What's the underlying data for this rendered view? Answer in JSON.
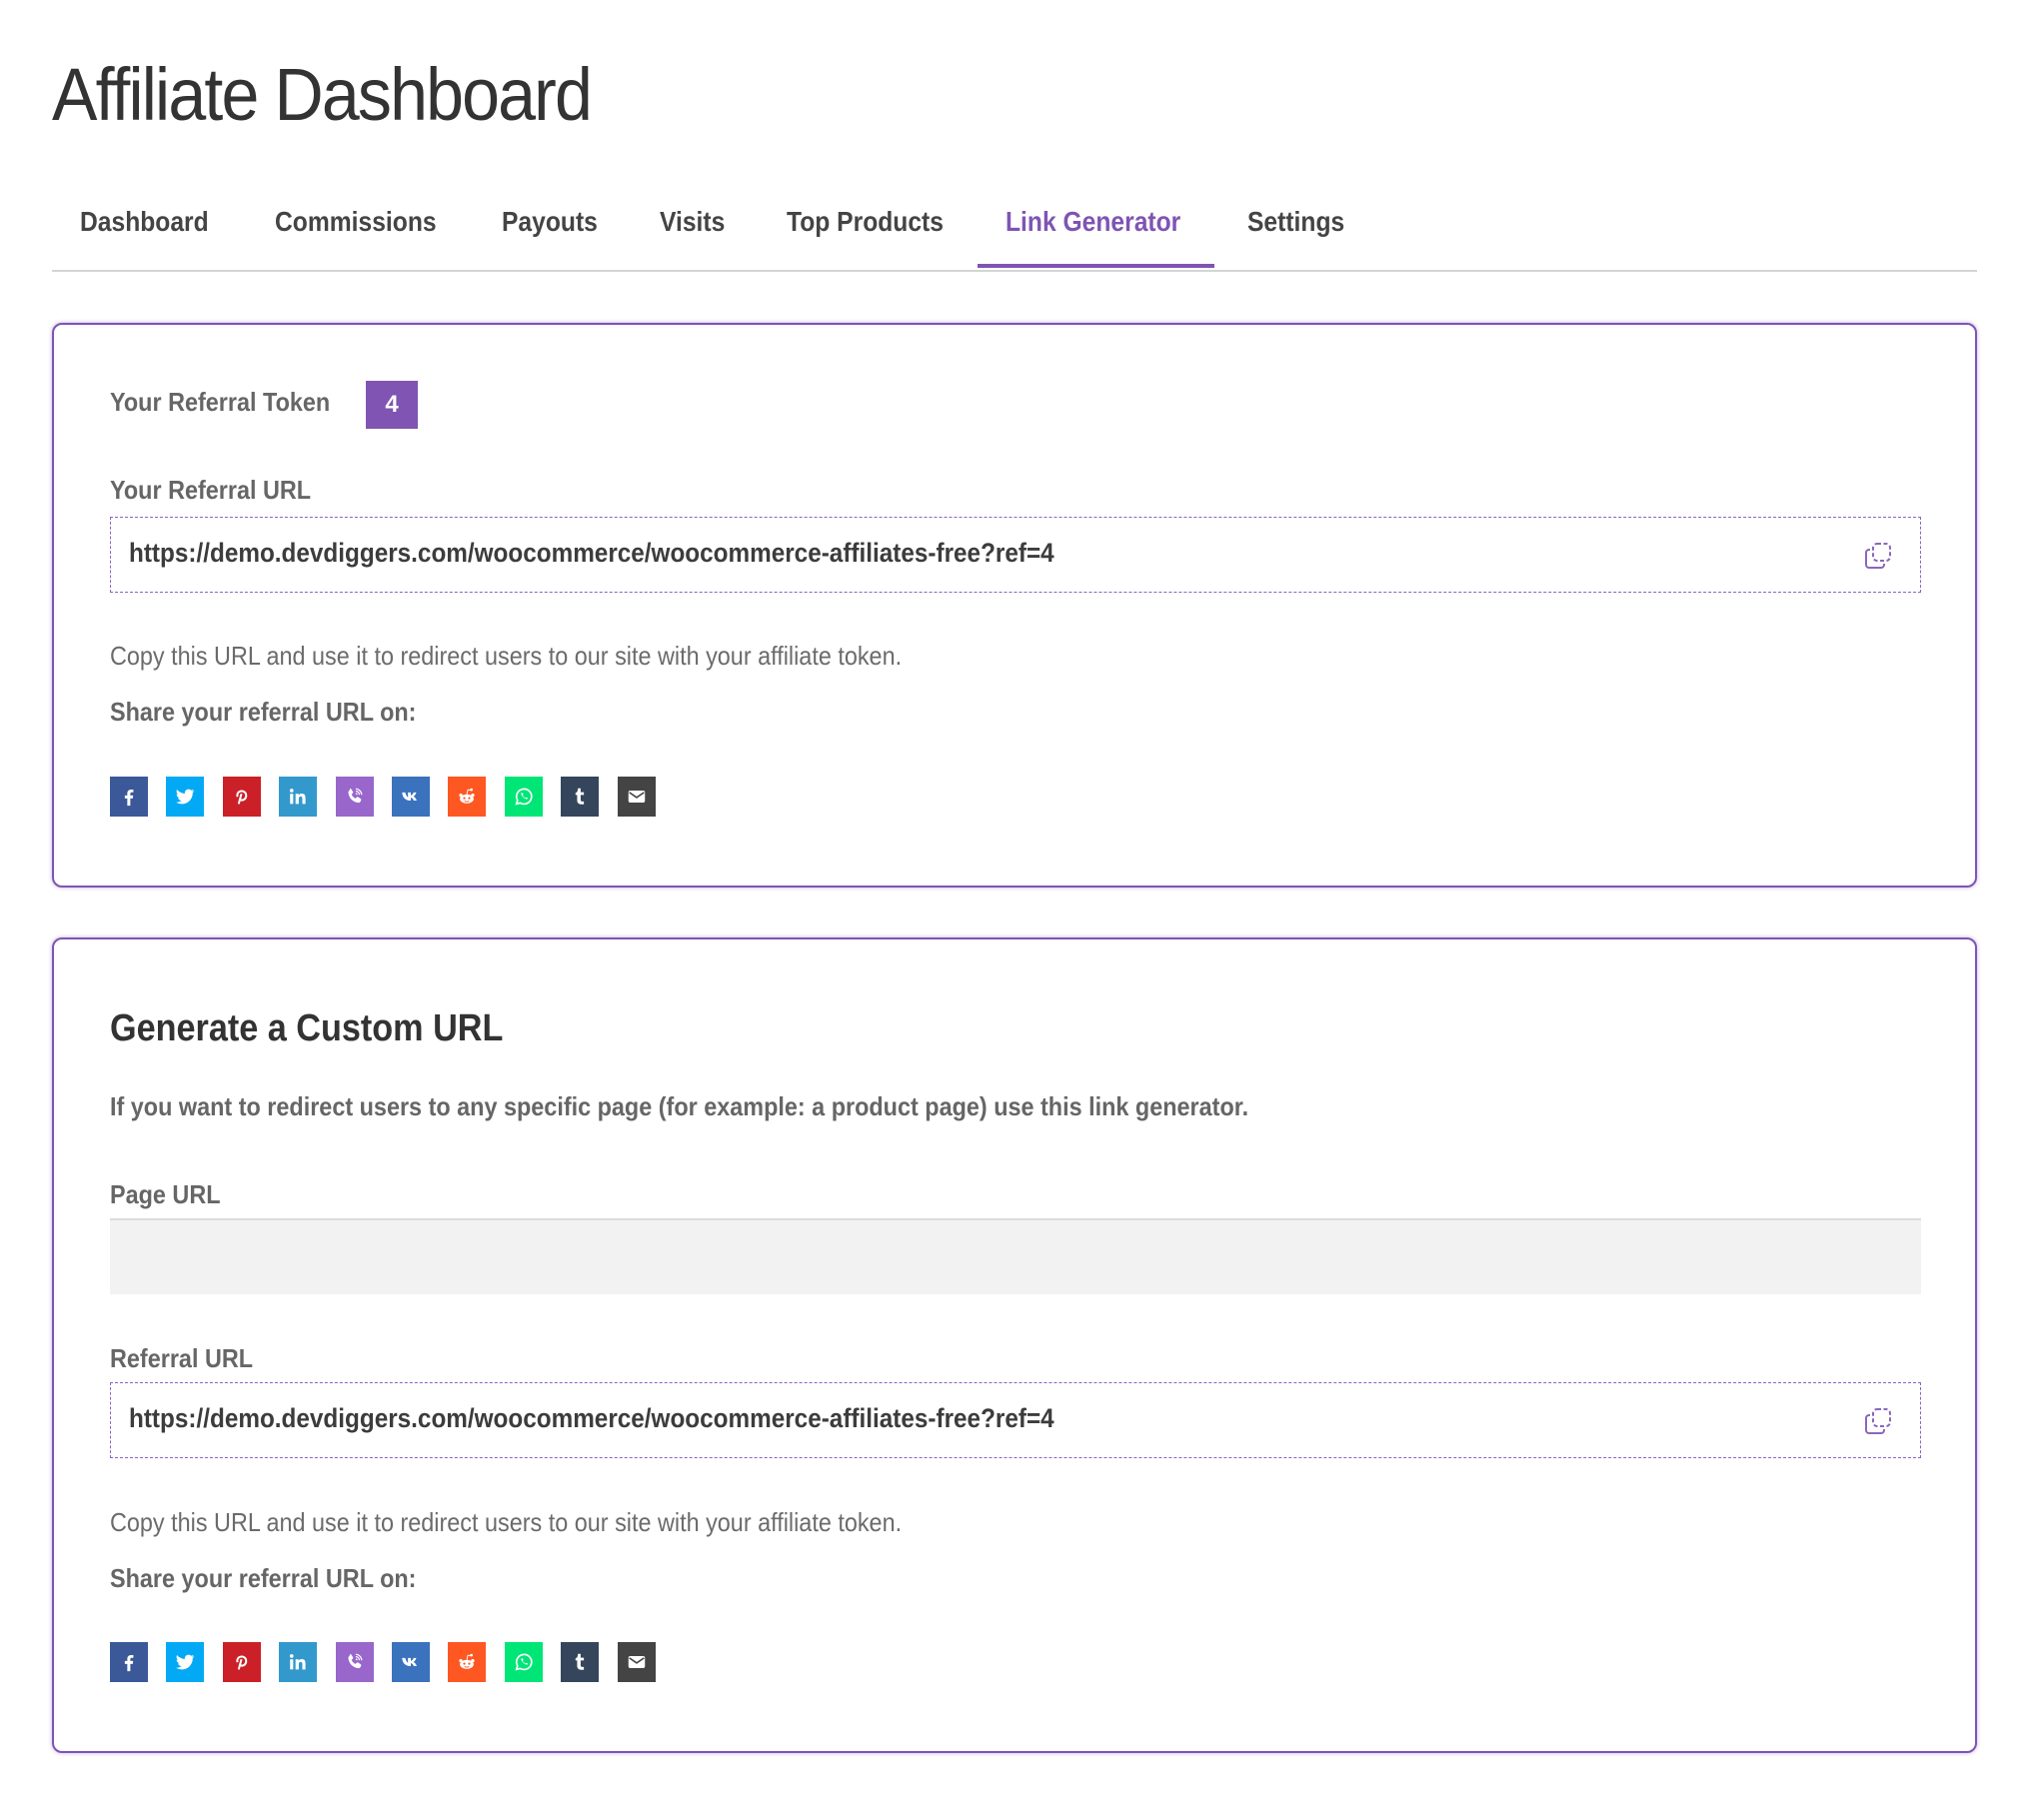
{
  "page": {
    "title": "Affiliate Dashboard"
  },
  "colors": {
    "accent": "#7f54b3",
    "text": "#444444",
    "muted": "#666666"
  },
  "tabs": [
    {
      "label": "Dashboard",
      "active": false
    },
    {
      "label": "Commissions",
      "active": false
    },
    {
      "label": "Payouts",
      "active": false
    },
    {
      "label": "Visits",
      "active": false
    },
    {
      "label": "Top Products",
      "active": false
    },
    {
      "label": "Link Generator",
      "active": true
    },
    {
      "label": "Settings",
      "active": false
    }
  ],
  "referral": {
    "token_label": "Your Referral Token",
    "token_value": "4",
    "url_label": "Your Referral URL",
    "url_value": "https://demo.devdiggers.com/woocommerce/woocommerce-affiliates-free?ref=4",
    "copy_icon": "copy-icon",
    "help_text": "Copy this URL and use it to redirect users to our site with your affiliate token.",
    "share_label": "Share your referral URL on:"
  },
  "custom": {
    "heading": "Generate a Custom URL",
    "description": "If you want to redirect users to any specific page (for example: a product page) use this link generator.",
    "page_url_label": "Page URL",
    "page_url_value": "",
    "referral_url_label": "Referral URL",
    "referral_url_value": "https://demo.devdiggers.com/woocommerce/woocommerce-affiliates-free?ref=4",
    "copy_icon": "copy-icon",
    "help_text": "Copy this URL and use it to redirect users to our site with your affiliate token.",
    "share_label": "Share your referral URL on:"
  },
  "share_networks": [
    {
      "name": "facebook",
      "icon": "facebook-icon",
      "color": "#3b5998"
    },
    {
      "name": "twitter",
      "icon": "twitter-icon",
      "color": "#03a9f4"
    },
    {
      "name": "pinterest",
      "icon": "pinterest-icon",
      "color": "#cb2027"
    },
    {
      "name": "linkedin",
      "icon": "linkedin-icon",
      "color": "#3399cc"
    },
    {
      "name": "viber",
      "icon": "viber-icon",
      "color": "#9966cc"
    },
    {
      "name": "vk",
      "icon": "vk-icon",
      "color": "#3b72bd"
    },
    {
      "name": "reddit",
      "icon": "reddit-icon",
      "color": "#ff5722"
    },
    {
      "name": "whatsapp",
      "icon": "whatsapp-icon",
      "color": "#00e676"
    },
    {
      "name": "tumblr",
      "icon": "tumblr-icon",
      "color": "#35465c"
    },
    {
      "name": "email",
      "icon": "email-icon",
      "color": "#444444"
    }
  ]
}
